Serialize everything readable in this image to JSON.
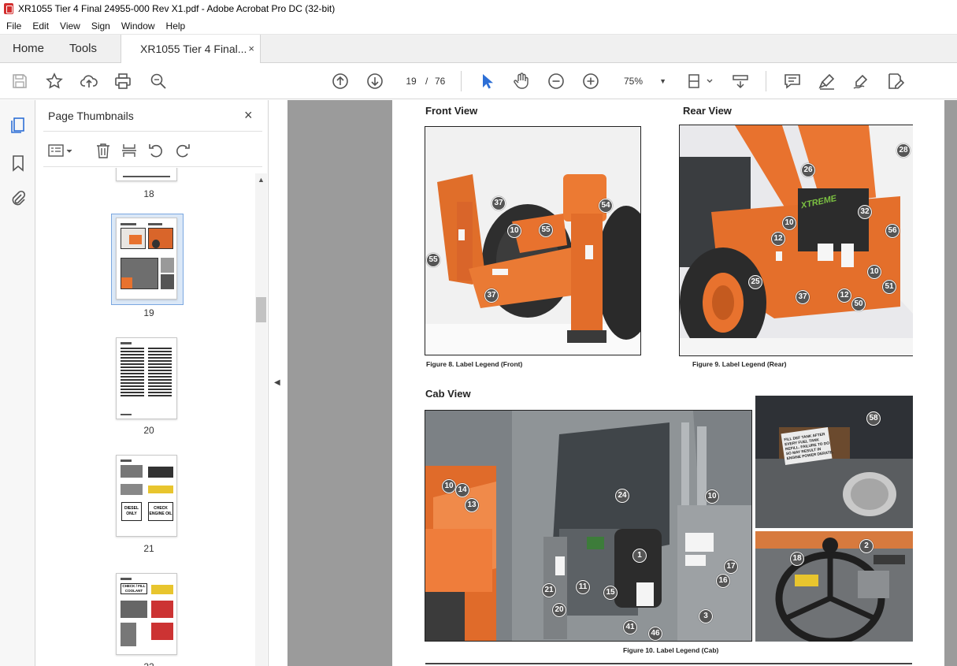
{
  "window": {
    "title": "XR1055 Tier 4 Final 24955-000 Rev X1.pdf - Adobe Acrobat Pro DC (32-bit)"
  },
  "menu": [
    "File",
    "Edit",
    "View",
    "Sign",
    "Window",
    "Help"
  ],
  "tabs": {
    "home": "Home",
    "tools": "Tools",
    "document": "XR1055 Tier 4 Final...",
    "close": "×"
  },
  "toolbar": {
    "current_page": "19",
    "separator": "/",
    "total_pages": "76",
    "zoom": "75%"
  },
  "sidebar": {
    "title": "Page Thumbnails",
    "close": "×",
    "thumbnails": [
      {
        "label": "18"
      },
      {
        "label": "19",
        "selected": true
      },
      {
        "label": "20"
      },
      {
        "label": "21"
      },
      {
        "label": "22"
      }
    ],
    "thumb21_text": {
      "diesel": "DIESEL ONLY",
      "check": "CHECK ENGINE OIL"
    },
    "thumb22_text": {
      "coolant": "CHECK / FILL COOLANT"
    }
  },
  "page": {
    "front_heading": "Front View",
    "rear_heading": "Rear View",
    "cab_heading": "Cab View",
    "front_caption": "Figure 8. Label Legend (Front)",
    "rear_caption": "Figure 9. Label Legend (Rear)",
    "cab_caption": "Figure 10. Label Legend (Cab)",
    "front_callouts": [
      "37",
      "55",
      "10",
      "54",
      "55",
      "37"
    ],
    "rear_callouts": [
      "28",
      "26",
      "10",
      "32",
      "56",
      "12",
      "25",
      "10",
      "51",
      "37",
      "12",
      "50"
    ],
    "cab_callouts": [
      "10",
      "14",
      "13",
      "24",
      "10",
      "1",
      "21",
      "11",
      "15",
      "17",
      "16",
      "20",
      "3",
      "41",
      "46"
    ],
    "def_callouts": [
      "58"
    ],
    "wheel_callouts": [
      "18",
      "2"
    ],
    "def_label_text": "FILL DEF TANK AFTER EVERY FUEL TANK REFILL. FAILURE TO DO SO MAY RESULT IN ENGINE POWER DERATE.",
    "boom_brand": "XTREME"
  },
  "colors": {
    "accent_orange": "#e8722e",
    "callout_grey": "#555555",
    "selected_thumb": "#dbe8f7"
  }
}
